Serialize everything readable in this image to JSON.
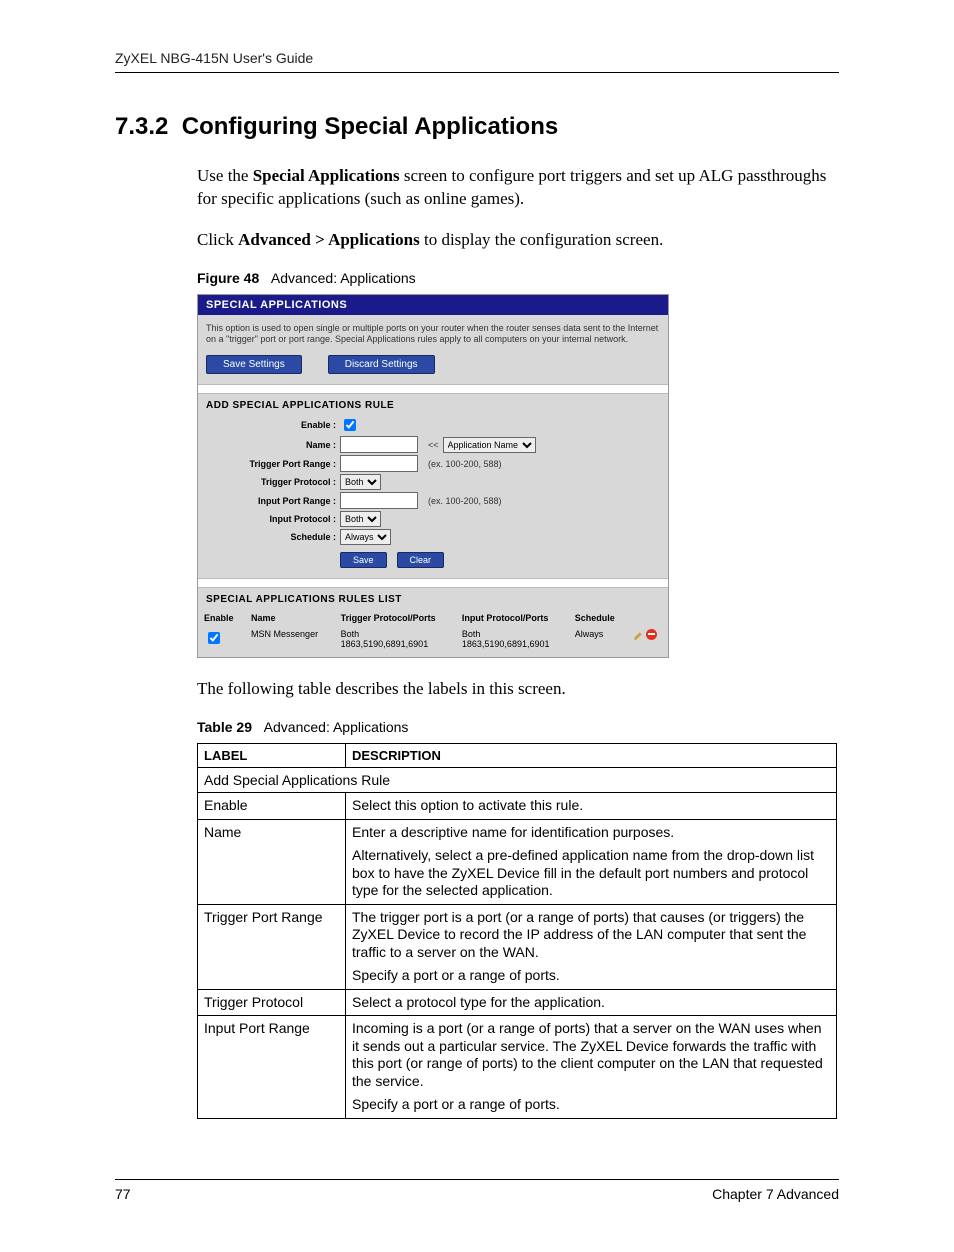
{
  "runningHead": "ZyXEL NBG-415N User's Guide",
  "section": {
    "number": "7.3.2",
    "title": "Configuring Special Applications"
  },
  "para1_a": "Use the ",
  "para1_b": "Special Applications",
  "para1_c": " screen to configure port triggers and set up ALG passthroughs for specific applications (such as online games).",
  "para2_a": "Click ",
  "para2_b": "Advanced > Applications",
  "para2_c": " to display the configuration screen.",
  "figure": {
    "label": "Figure 48",
    "title": "Advanced: Applications"
  },
  "shot": {
    "header": "SPECIAL APPLICATIONS",
    "desc": "This option is used to open single or multiple ports on your router when the router senses data sent to the Internet on a \"trigger\" port or port range. Special Applications rules apply to all computers on your internal network.",
    "saveBtn": "Save Settings",
    "discardBtn": "Discard Settings",
    "addTitle": "ADD SPECIAL APPLICATIONS RULE",
    "labels": {
      "enable": "Enable :",
      "name": "Name :",
      "triggerRange": "Trigger Port Range :",
      "triggerProto": "Trigger Protocol :",
      "inputRange": "Input Port Range :",
      "inputProto": "Input Protocol :",
      "schedule": "Schedule :"
    },
    "appNameArrow": "<<",
    "appNameSel": "Application Name",
    "hint": "(ex. 100-200, 588)",
    "protoOpt": "Both",
    "schedOpt": "Always",
    "saveSm": "Save",
    "clearSm": "Clear",
    "listTitle": "SPECIAL APPLICATIONS RULES LIST",
    "cols": {
      "enable": "Enable",
      "name": "Name",
      "trigger": "Trigger Protocol/Ports",
      "input": "Input Protocol/Ports",
      "schedule": "Schedule"
    },
    "row": {
      "name": "MSN Messenger",
      "tproto": "Both",
      "tports": "1863,5190,6891,6901",
      "iproto": "Both",
      "iports": "1863,5190,6891,6901",
      "sched": "Always"
    }
  },
  "afterShot": "The following table describes the labels in this screen.",
  "table": {
    "label": "Table 29",
    "title": "Advanced: Applications"
  },
  "th": {
    "label": "LABEL",
    "desc": "DESCRIPTION"
  },
  "rows": {
    "span1": "Add Special Applications Rule",
    "r1": {
      "l": "Enable",
      "d": "Select this option to activate this rule."
    },
    "r2": {
      "l": "Name",
      "d1": "Enter a descriptive name for identification purposes.",
      "d2": "Alternatively, select a pre-defined application name from the drop-down list box to have the ZyXEL Device fill in the default port numbers and protocol type for the selected application."
    },
    "r3": {
      "l": "Trigger Port Range",
      "d1": "The trigger port is a port (or a range of ports) that causes (or triggers) the ZyXEL Device to record the IP address of the LAN computer that sent the traffic to a server on the WAN.",
      "d2": "Specify a port or a range of ports."
    },
    "r4": {
      "l": "Trigger Protocol",
      "d": "Select a protocol type for the application."
    },
    "r5": {
      "l": "Input Port Range",
      "d1": "Incoming is a port (or a range of ports) that a server on the WAN uses when it sends out a particular service. The ZyXEL Device forwards the traffic with this port (or range of ports) to the client computer on the LAN that requested the service.",
      "d2": "Specify a port or a range of ports."
    }
  },
  "footer": {
    "page": "77",
    "chapter": "Chapter 7 Advanced"
  }
}
